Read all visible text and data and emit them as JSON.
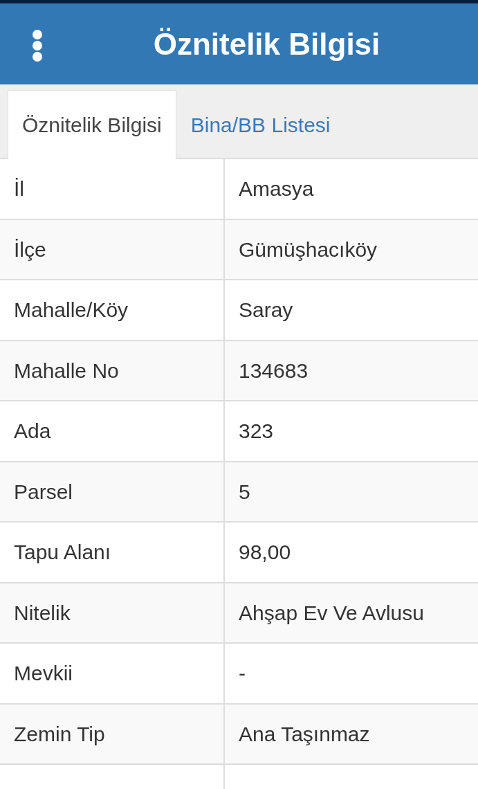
{
  "header": {
    "title": "Öznitelik Bilgisi"
  },
  "tabs": [
    {
      "label": "Öznitelik Bilgisi",
      "selected": true
    },
    {
      "label": "Bina/BB Listesi",
      "selected": false
    }
  ],
  "table": {
    "rows": [
      {
        "label": "İl",
        "value": "Amasya"
      },
      {
        "label": "İlçe",
        "value": "Gümüşhacıköy"
      },
      {
        "label": "Mahalle/Köy",
        "value": "Saray"
      },
      {
        "label": "Mahalle No",
        "value": "134683"
      },
      {
        "label": "Ada",
        "value": "323"
      },
      {
        "label": "Parsel",
        "value": "5"
      },
      {
        "label": "Tapu Alanı",
        "value": "98,00"
      },
      {
        "label": "Nitelik",
        "value": "Ahşap Ev Ve Avlusu"
      },
      {
        "label": "Mevkii",
        "value": "-"
      },
      {
        "label": "Zemin Tip",
        "value": "Ana Taşınmaz"
      }
    ]
  }
}
